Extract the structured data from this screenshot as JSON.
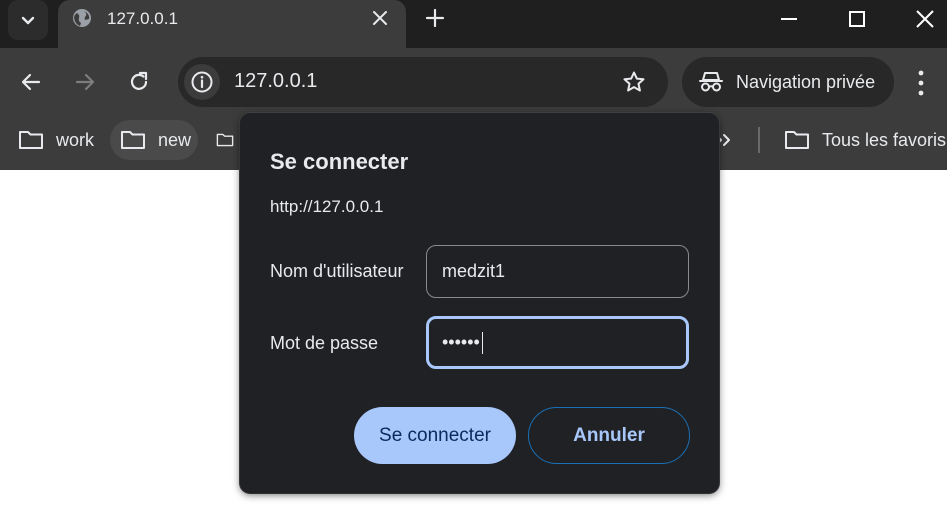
{
  "tab": {
    "title": "127.0.0.1"
  },
  "omnibox": {
    "url": "127.0.0.1"
  },
  "profile": {
    "label": "Navigation privée"
  },
  "bookmarks": {
    "items": [
      {
        "label": "work"
      },
      {
        "label": "new"
      },
      {
        "label": ""
      }
    ],
    "all_label": "Tous les favoris"
  },
  "dialog": {
    "title": "Se connecter",
    "origin": "http://127.0.0.1",
    "username_label": "Nom d'utilisateur",
    "username_value": "medzit1",
    "password_label": "Mot de passe",
    "password_value": "••••••",
    "submit_label": "Se connecter",
    "cancel_label": "Annuler"
  },
  "colors": {
    "accent": "#a8c7fa",
    "chrome_dark": "#1f1f1f",
    "chrome_toolbar": "#3c3c3c",
    "dialog_bg": "#202124"
  }
}
